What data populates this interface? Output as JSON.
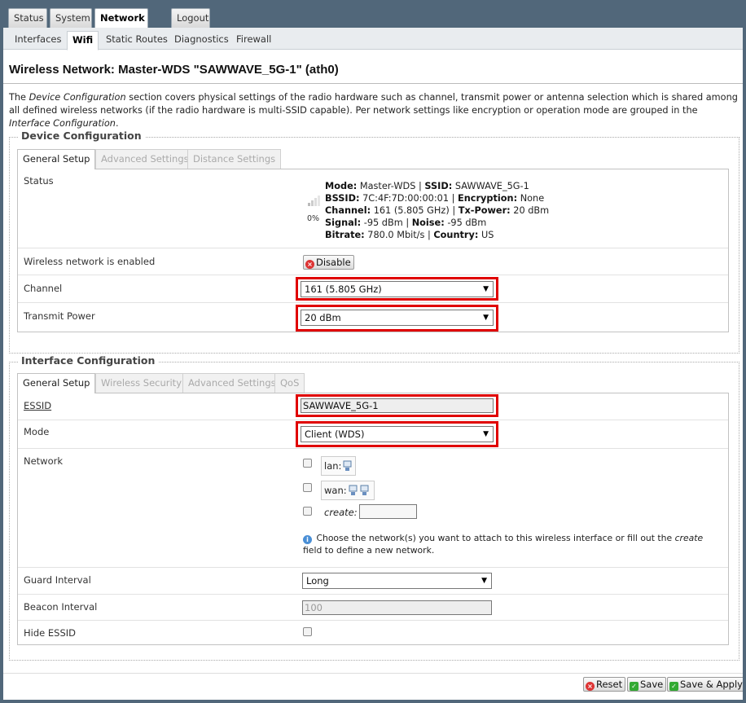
{
  "main_tabs": [
    "Status",
    "System",
    "Network",
    "Logout"
  ],
  "sub_tabs": [
    "Interfaces",
    "Wifi",
    "Static Routes",
    "Diagnostics",
    "Firewall"
  ],
  "page_title": "Wireless Network: Master-WDS \"SAWWAVE_5G-1\" (ath0)",
  "description": {
    "p1": "The ",
    "em1": "Device Configuration",
    "p2": " section covers physical settings of the radio hardware such as channel, transmit power or antenna selection which is shared among all defined wireless networks (if the radio hardware is multi-SSID capable). Per network settings like encryption or operation mode are grouped in the ",
    "em2": "Interface Configuration",
    "p3": "."
  },
  "device": {
    "legend": "Device Configuration",
    "tabs": [
      "General Setup",
      "Advanced Settings",
      "Distance Settings"
    ],
    "status_label": "Status",
    "signal_percent": "0%",
    "status": {
      "mode_label": "Mode:",
      "mode": "Master-WDS",
      "ssid_label": "SSID:",
      "ssid": "SAWWAVE_5G-1",
      "bssid_label": "BSSID:",
      "bssid": "7C:4F:7D:00:00:01",
      "encryption_label": "Encryption:",
      "encryption": "None",
      "channel_label": "Channel:",
      "channel": "161 (5.805 GHz)",
      "txpower_label": "Tx-Power:",
      "txpower": "20 dBm",
      "signal_label": "Signal:",
      "signal": "-95 dBm",
      "noise_label": "Noise:",
      "noise": "-95 dBm",
      "bitrate_label": "Bitrate:",
      "bitrate": "780.0 Mbit/s",
      "country_label": "Country:",
      "country": "US",
      "sep": "|"
    },
    "enabled_label": "Wireless network is enabled",
    "disable_button": "Disable",
    "channel_label": "Channel",
    "channel_value": "161 (5.805 GHz)",
    "txpower_label": "Transmit Power",
    "txpower_value": "20 dBm"
  },
  "iface": {
    "legend": "Interface Configuration",
    "tabs": [
      "General Setup",
      "Wireless Security",
      "Advanced Settings",
      "QoS"
    ],
    "essid_label": "ESSID",
    "essid_value": "SAWWAVE_5G-1",
    "mode_label": "Mode",
    "mode_value": "Client (WDS)",
    "network_label": "Network",
    "networks": [
      "lan:",
      "wan:"
    ],
    "create_label": "create:",
    "help_p1": "Choose the network(s) you want to attach to this wireless interface or fill out the ",
    "help_em": "create",
    "help_p2": " field to define a new network.",
    "guard_label": "Guard Interval",
    "guard_value": "Long",
    "beacon_label": "Beacon Interval",
    "beacon_placeholder": "100",
    "hide_label": "Hide ESSID"
  },
  "buttons": {
    "reset": "Reset",
    "save": "Save",
    "save_apply": "Save & Apply"
  },
  "colors": {
    "highlight": "#e00000",
    "chrome": "#51677a"
  }
}
